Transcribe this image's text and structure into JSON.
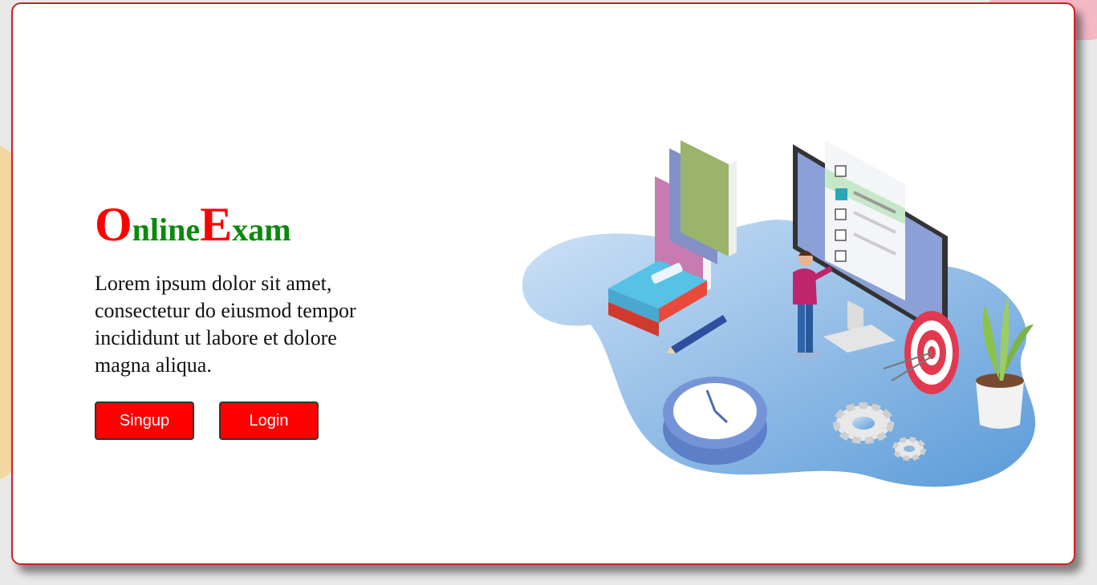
{
  "brand": {
    "o_letter": "O",
    "nline": "nline",
    "e_letter": "E",
    "xam": "xam"
  },
  "hero": {
    "description": "Lorem ipsum dolor sit amet, consectetur do eiusmod tempor incididunt ut labore et dolore magna aliqua."
  },
  "actions": {
    "signup_label": "Singup",
    "login_label": "Login"
  },
  "colors": {
    "accent_red": "#ff0000",
    "brand_green": "#0a8a0a",
    "card_border": "#d41f1f"
  },
  "illustration": {
    "icon": "online-exam-isometric-illustration"
  }
}
